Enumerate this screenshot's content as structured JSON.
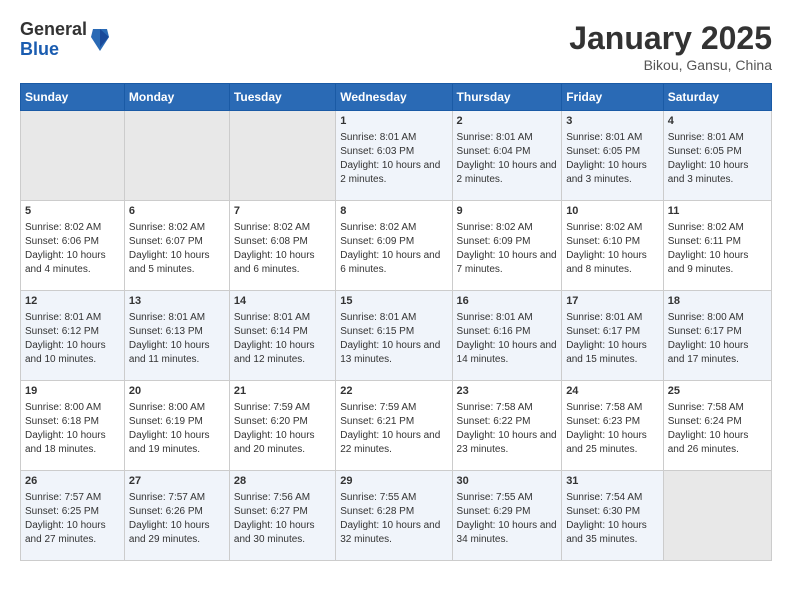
{
  "header": {
    "logo_general": "General",
    "logo_blue": "Blue",
    "month_title": "January 2025",
    "location": "Bikou, Gansu, China"
  },
  "weekdays": [
    "Sunday",
    "Monday",
    "Tuesday",
    "Wednesday",
    "Thursday",
    "Friday",
    "Saturday"
  ],
  "weeks": [
    [
      {
        "day": "",
        "sunrise": "",
        "sunset": "",
        "daylight": ""
      },
      {
        "day": "",
        "sunrise": "",
        "sunset": "",
        "daylight": ""
      },
      {
        "day": "",
        "sunrise": "",
        "sunset": "",
        "daylight": ""
      },
      {
        "day": "1",
        "sunrise": "Sunrise: 8:01 AM",
        "sunset": "Sunset: 6:03 PM",
        "daylight": "Daylight: 10 hours and 2 minutes."
      },
      {
        "day": "2",
        "sunrise": "Sunrise: 8:01 AM",
        "sunset": "Sunset: 6:04 PM",
        "daylight": "Daylight: 10 hours and 2 minutes."
      },
      {
        "day": "3",
        "sunrise": "Sunrise: 8:01 AM",
        "sunset": "Sunset: 6:05 PM",
        "daylight": "Daylight: 10 hours and 3 minutes."
      },
      {
        "day": "4",
        "sunrise": "Sunrise: 8:01 AM",
        "sunset": "Sunset: 6:05 PM",
        "daylight": "Daylight: 10 hours and 3 minutes."
      }
    ],
    [
      {
        "day": "5",
        "sunrise": "Sunrise: 8:02 AM",
        "sunset": "Sunset: 6:06 PM",
        "daylight": "Daylight: 10 hours and 4 minutes."
      },
      {
        "day": "6",
        "sunrise": "Sunrise: 8:02 AM",
        "sunset": "Sunset: 6:07 PM",
        "daylight": "Daylight: 10 hours and 5 minutes."
      },
      {
        "day": "7",
        "sunrise": "Sunrise: 8:02 AM",
        "sunset": "Sunset: 6:08 PM",
        "daylight": "Daylight: 10 hours and 6 minutes."
      },
      {
        "day": "8",
        "sunrise": "Sunrise: 8:02 AM",
        "sunset": "Sunset: 6:09 PM",
        "daylight": "Daylight: 10 hours and 6 minutes."
      },
      {
        "day": "9",
        "sunrise": "Sunrise: 8:02 AM",
        "sunset": "Sunset: 6:09 PM",
        "daylight": "Daylight: 10 hours and 7 minutes."
      },
      {
        "day": "10",
        "sunrise": "Sunrise: 8:02 AM",
        "sunset": "Sunset: 6:10 PM",
        "daylight": "Daylight: 10 hours and 8 minutes."
      },
      {
        "day": "11",
        "sunrise": "Sunrise: 8:02 AM",
        "sunset": "Sunset: 6:11 PM",
        "daylight": "Daylight: 10 hours and 9 minutes."
      }
    ],
    [
      {
        "day": "12",
        "sunrise": "Sunrise: 8:01 AM",
        "sunset": "Sunset: 6:12 PM",
        "daylight": "Daylight: 10 hours and 10 minutes."
      },
      {
        "day": "13",
        "sunrise": "Sunrise: 8:01 AM",
        "sunset": "Sunset: 6:13 PM",
        "daylight": "Daylight: 10 hours and 11 minutes."
      },
      {
        "day": "14",
        "sunrise": "Sunrise: 8:01 AM",
        "sunset": "Sunset: 6:14 PM",
        "daylight": "Daylight: 10 hours and 12 minutes."
      },
      {
        "day": "15",
        "sunrise": "Sunrise: 8:01 AM",
        "sunset": "Sunset: 6:15 PM",
        "daylight": "Daylight: 10 hours and 13 minutes."
      },
      {
        "day": "16",
        "sunrise": "Sunrise: 8:01 AM",
        "sunset": "Sunset: 6:16 PM",
        "daylight": "Daylight: 10 hours and 14 minutes."
      },
      {
        "day": "17",
        "sunrise": "Sunrise: 8:01 AM",
        "sunset": "Sunset: 6:17 PM",
        "daylight": "Daylight: 10 hours and 15 minutes."
      },
      {
        "day": "18",
        "sunrise": "Sunrise: 8:00 AM",
        "sunset": "Sunset: 6:17 PM",
        "daylight": "Daylight: 10 hours and 17 minutes."
      }
    ],
    [
      {
        "day": "19",
        "sunrise": "Sunrise: 8:00 AM",
        "sunset": "Sunset: 6:18 PM",
        "daylight": "Daylight: 10 hours and 18 minutes."
      },
      {
        "day": "20",
        "sunrise": "Sunrise: 8:00 AM",
        "sunset": "Sunset: 6:19 PM",
        "daylight": "Daylight: 10 hours and 19 minutes."
      },
      {
        "day": "21",
        "sunrise": "Sunrise: 7:59 AM",
        "sunset": "Sunset: 6:20 PM",
        "daylight": "Daylight: 10 hours and 20 minutes."
      },
      {
        "day": "22",
        "sunrise": "Sunrise: 7:59 AM",
        "sunset": "Sunset: 6:21 PM",
        "daylight": "Daylight: 10 hours and 22 minutes."
      },
      {
        "day": "23",
        "sunrise": "Sunrise: 7:58 AM",
        "sunset": "Sunset: 6:22 PM",
        "daylight": "Daylight: 10 hours and 23 minutes."
      },
      {
        "day": "24",
        "sunrise": "Sunrise: 7:58 AM",
        "sunset": "Sunset: 6:23 PM",
        "daylight": "Daylight: 10 hours and 25 minutes."
      },
      {
        "day": "25",
        "sunrise": "Sunrise: 7:58 AM",
        "sunset": "Sunset: 6:24 PM",
        "daylight": "Daylight: 10 hours and 26 minutes."
      }
    ],
    [
      {
        "day": "26",
        "sunrise": "Sunrise: 7:57 AM",
        "sunset": "Sunset: 6:25 PM",
        "daylight": "Daylight: 10 hours and 27 minutes."
      },
      {
        "day": "27",
        "sunrise": "Sunrise: 7:57 AM",
        "sunset": "Sunset: 6:26 PM",
        "daylight": "Daylight: 10 hours and 29 minutes."
      },
      {
        "day": "28",
        "sunrise": "Sunrise: 7:56 AM",
        "sunset": "Sunset: 6:27 PM",
        "daylight": "Daylight: 10 hours and 30 minutes."
      },
      {
        "day": "29",
        "sunrise": "Sunrise: 7:55 AM",
        "sunset": "Sunset: 6:28 PM",
        "daylight": "Daylight: 10 hours and 32 minutes."
      },
      {
        "day": "30",
        "sunrise": "Sunrise: 7:55 AM",
        "sunset": "Sunset: 6:29 PM",
        "daylight": "Daylight: 10 hours and 34 minutes."
      },
      {
        "day": "31",
        "sunrise": "Sunrise: 7:54 AM",
        "sunset": "Sunset: 6:30 PM",
        "daylight": "Daylight: 10 hours and 35 minutes."
      },
      {
        "day": "",
        "sunrise": "",
        "sunset": "",
        "daylight": ""
      }
    ]
  ]
}
